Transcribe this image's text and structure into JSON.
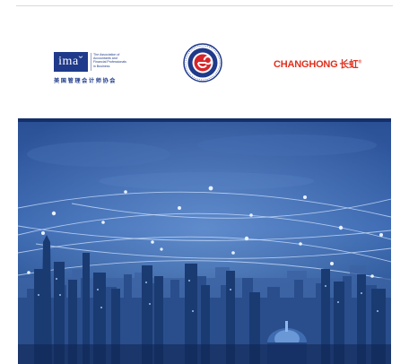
{
  "logos": {
    "ima": {
      "mark": "imaˇ",
      "description": "The Association of\nAccountants and\nFinancial Professionals\nin Business",
      "chinese_name": "美国管理会计师协会",
      "color": "#1f3a8a"
    },
    "emblem": {
      "icon": "circular-seal-emblem-icon",
      "colors": [
        "#1f3a8a",
        "#d6262b"
      ]
    },
    "changhong": {
      "latin": "CHANGHONG",
      "chinese": "长虹",
      "mark": "®",
      "color": "#e0301e"
    }
  },
  "banner": {
    "image": "night-city-skyline-with-network-lines",
    "colors": [
      "#14306a",
      "#2b5aa6",
      "#6fa2e0"
    ]
  }
}
